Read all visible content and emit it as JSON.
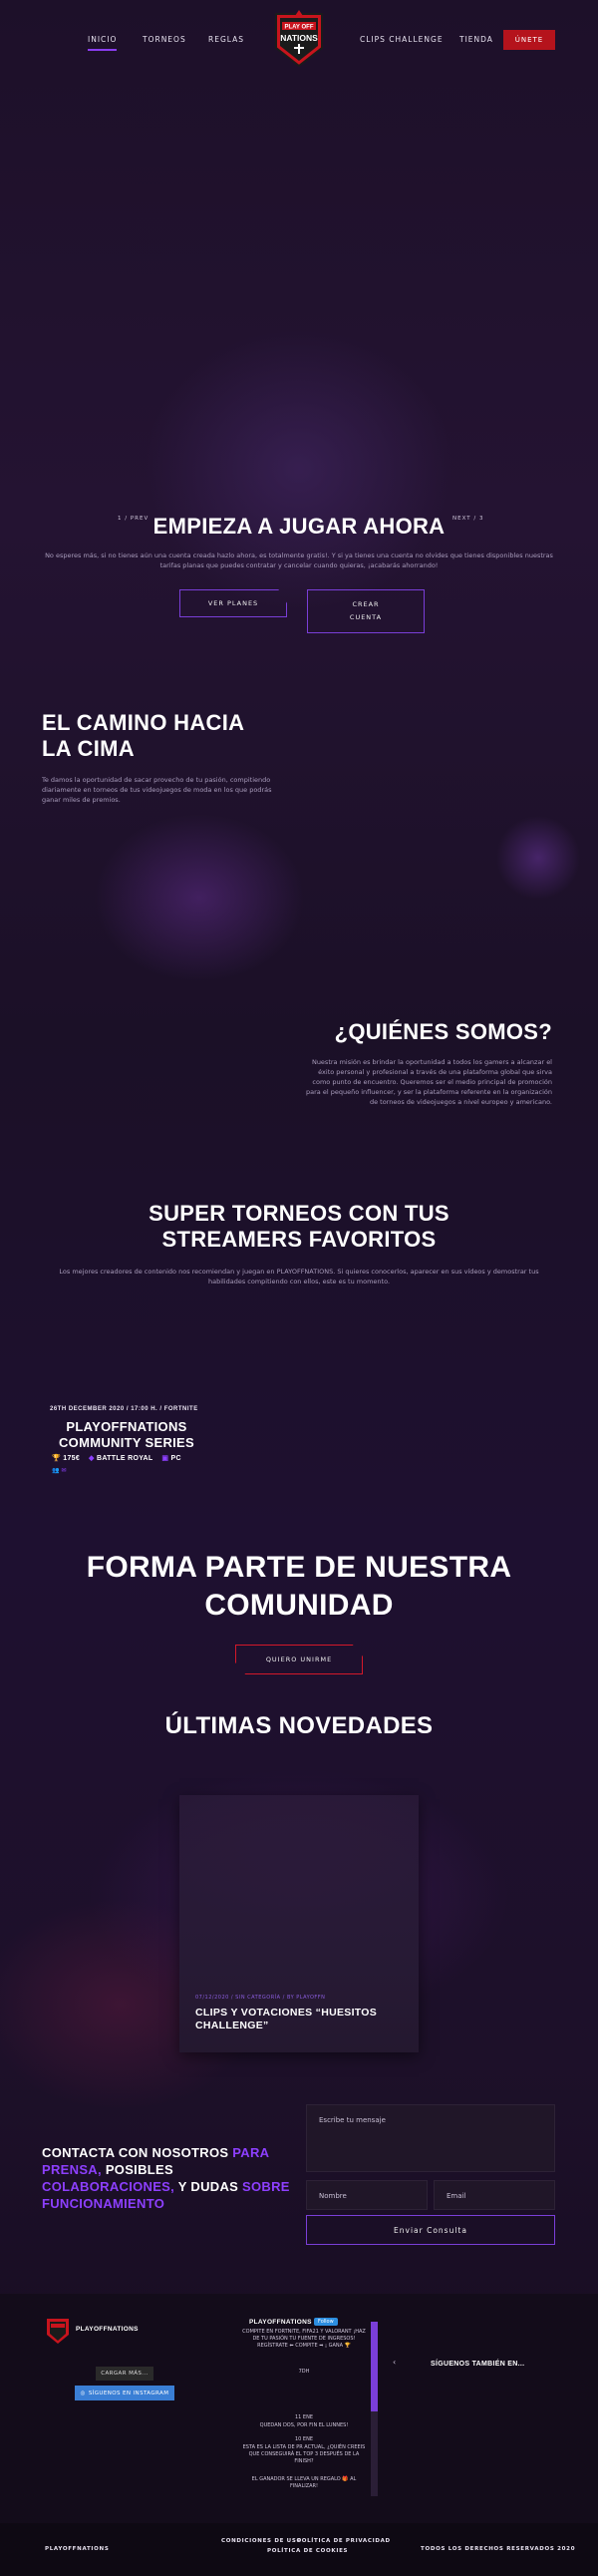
{
  "nav": {
    "left": [
      "INICIO",
      "TORNEOS",
      "REGLAS"
    ],
    "right": [
      "CLIPS CHALLENGE",
      "TIENDA"
    ],
    "join": "ÚNETE",
    "logo_top": "PLAY OFF",
    "logo_main": "NATIONS"
  },
  "hero": {
    "prev": "1 / PREV",
    "next": "NEXT / 3",
    "title": "EMPIEZA A JUGAR AHORA",
    "text": "No esperes más, si no tienes aún una cuenta creada hazlo ahora, es totalmente gratis!. Y si ya tienes una cuenta no olvides que tienes disponibles nuestras tarifas planas que puedes contratar y cancelar cuando quieras, ¡acabarás ahorrando!",
    "btn_plans": "VER PLANES",
    "btn_account": "CREAR CUENTA"
  },
  "camino": {
    "title": "EL CAMINO HACIA LA CIMA",
    "text": "Te damos la oportunidad de sacar provecho de tu pasión, compitiendo diariamente en torneos de tus videojuegos de moda en los que podrás ganar miles de premios."
  },
  "quienes": {
    "title": "¿QUIÉNES SOMOS?",
    "text": "Nuestra misión es brindar la oportunidad a todos los gamers a alcanzar el éxito personal y profesional a través de una plataforma global que sirva como punto de encuentro. Queremos ser el medio principal de promoción para el pequeño influencer, y ser la plataforma referente en la organización de torneos de videojuegos a nivel europeo y americano."
  },
  "streamers": {
    "title": "SUPER TORNEOS CON TUS STREAMERS FAVORITOS",
    "text": "Los mejores creadores de contenido nos recomiendan y juegan en PLAYOFFNATIONS. Si quieres conocerlos, aparecer en sus vídeos y demostrar tus habilidades compitiendo con ellos, este es tu momento."
  },
  "tournament": {
    "meta": "26TH DECEMBER 2020 / 17:00 H. / FORTNITE",
    "title": "PLAYOFFNATIONS COMMUNITY SERIES",
    "prize": "175€",
    "mode": "BATTLE ROYAL",
    "platform": "PC"
  },
  "community": {
    "title": "FORMA PARTE DE NUESTRA COMUNIDAD",
    "button": "QUIERO UNIRME"
  },
  "news": {
    "title": "ÚLTIMAS NOVEDADES",
    "card_meta": "07/12/2020 / SIN CATEGORÍA / BY PLAYOFFN",
    "card_title": "CLIPS Y VOTACIONES “HUESITOS CHALLENGE”"
  },
  "contact": {
    "title_1": "CONTACTA CON NOSOTROS",
    "title_2": "PARA",
    "title_3": "PRENSA,",
    "title_4": "POSIBLES",
    "title_5": "COLABORACIONES,",
    "title_6": "Y DUDAS",
    "title_7": "SOBRE FUNCIONAMIENTO",
    "message_placeholder": "Escribe tu mensaje",
    "name_placeholder": "Nombre",
    "email_placeholder": "Email",
    "send": "Enviar Consulta"
  },
  "footer": {
    "brand": "PLAYOFFNATIONS",
    "load_more": "CARGAR MÁS...",
    "instagram": "SÍGUENOS EN INSTAGRAM",
    "tw_name": "PLAYOFFNATIONS",
    "tw_follow": "Follow",
    "tw_text": "COMPITE EN FORTNITE, FIFA21 Y VALORANT ¡HAZ DE TU PASIÓN TU FUENTE DE INGRESOS! REGÍSTRATE ⬅ COMPITE ➡ ¡ GANA 🏆",
    "tw_date_1": "7DH",
    "tw_date_2": "11 ENE",
    "tw_text_2": "QUEDAN DOS, POR FIN EL LUNNES!",
    "tw_date_3": "10 ENE",
    "tw_text_3": "ESTA ES LA LISTA DE PR ACTUAL, ¿QUIÉN CREEIS QUE CONSEGUIRÁ EL TOP 3 DESPUÉS DE LA FINISH?",
    "tw_text_4": "EL GANADOR SE LLEVA UN REGALO 🎁 AL FINALIZAR!",
    "follow_also": "SÍGUENOS TAMBIÉN EN...",
    "brand_bottom": "PLAYOFFNATIONS",
    "terms": "CONDICIONES DE USO",
    "privacy": "POLÍTICA DE PRIVACIDAD",
    "cookies": "POLÍTICA DE COOKIES",
    "rights": "TODOS LOS DERECHOS RESERVADOS 2020"
  },
  "colors": {
    "accent": "#8d3fff",
    "brand_red": "#b5131c",
    "background": "#1a0f26"
  }
}
